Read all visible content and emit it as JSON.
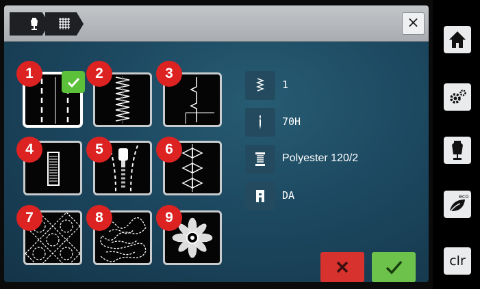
{
  "header": {
    "crumbs": [
      {
        "icon": "dress-form-icon"
      },
      {
        "icon": "fabric-grid-icon"
      }
    ],
    "close_glyph": "×"
  },
  "fabric_tiles": [
    {
      "number": "1",
      "pattern": "straight-seam",
      "selected": true
    },
    {
      "number": "2",
      "pattern": "zigzag-seam",
      "selected": false
    },
    {
      "number": "3",
      "pattern": "blind-hem",
      "selected": false
    },
    {
      "number": "4",
      "pattern": "buttonhole",
      "selected": false
    },
    {
      "number": "5",
      "pattern": "zipper",
      "selected": false
    },
    {
      "number": "6",
      "pattern": "decorative-triangles",
      "selected": false
    },
    {
      "number": "7",
      "pattern": "quilting-diamonds",
      "selected": false
    },
    {
      "number": "8",
      "pattern": "stippling",
      "selected": false
    },
    {
      "number": "9",
      "pattern": "embroidery-flower",
      "selected": false
    }
  ],
  "info": {
    "presser_foot": {
      "icon": "stitch-icon",
      "value": "1"
    },
    "needle": {
      "icon": "needle-icon",
      "value": "70H"
    },
    "thread": {
      "icon": "thread-spool-icon",
      "value": "Polyester 120/2"
    },
    "stabilizer": {
      "icon": "presser-foot-icon",
      "value": "DA"
    }
  },
  "actions": {
    "cancel_glyph": "✕",
    "confirm_glyph": "✓"
  },
  "sidebar": {
    "buttons": [
      {
        "icon": "home-icon"
      },
      {
        "icon": "settings-gears-icon"
      },
      {
        "icon": "dress-form-icon"
      },
      {
        "icon": "eco-leaf-icon",
        "label": "eco"
      },
      {
        "icon": "clr-icon",
        "label": "clr"
      }
    ]
  },
  "colors": {
    "badge_red": "#dd2222",
    "confirm_green": "#6cc24a",
    "cancel_red": "#d8322e",
    "screen_teal": "#1c4860"
  }
}
